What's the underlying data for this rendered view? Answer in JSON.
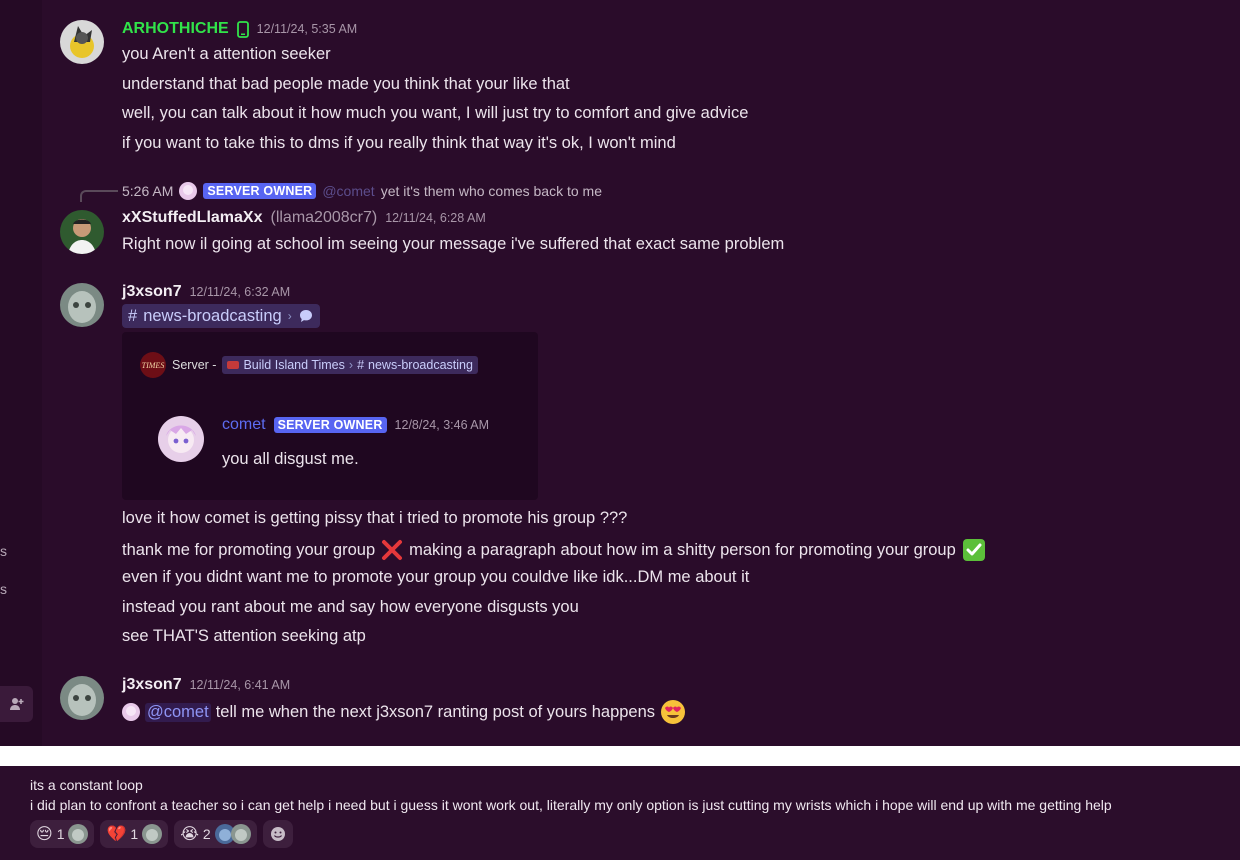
{
  "side_rail": {
    "chars": [
      "s",
      "s"
    ]
  },
  "messages": {
    "m1": {
      "user": "ARHOTHICHE",
      "device_icon": "phone-icon",
      "timestamp": "12/11/24, 5:35 AM",
      "lines": [
        "you Aren't a attention seeker",
        "understand that bad people made you think that your like that",
        "well, you can talk about it how much you want, I will just try to comfort and give advice",
        "if you want to take this to dms if you really think that way it's ok, I won't mind"
      ]
    },
    "m2": {
      "reply": {
        "time": "5:26 AM",
        "tag": "SERVER OWNER",
        "mention": "@comet",
        "text": "yet it's them who comes back to me"
      },
      "user": "xXStuffedLlamaXx",
      "handle": "(llama2008cr7)",
      "timestamp": "12/11/24, 6:28 AM",
      "line": "Right now il going at school im seeing your message i've suffered that exact same problem"
    },
    "m3": {
      "user": "j3xson7",
      "timestamp": "12/11/24, 6:32 AM",
      "channel": "news-broadcasting",
      "embed": {
        "prefix": "Server -",
        "logo_text": "TIMES",
        "server": "Build Island Times",
        "channel": "news-broadcasting",
        "quoted_user": "comet",
        "quoted_tag": "SERVER OWNER",
        "quoted_time": "12/8/24, 3:46 AM",
        "quoted_text": "you all disgust me."
      },
      "lines": [
        "love it how comet is getting pissy that i tried to promote his group ???",
        "thank me for promoting your group",
        "making a paragraph about how im a shitty person for promoting your group",
        "even if you didnt want me to promote your group you couldve like idk...DM me about it",
        "instead you rant about me and say how everyone disgusts you",
        "see THAT'S attention seeking atp"
      ]
    },
    "m4": {
      "user": "j3xson7",
      "timestamp": "12/11/24, 6:41 AM",
      "mention": "@comet",
      "text": "tell me when the next j3xson7 ranting post of yours happens"
    }
  },
  "bottom": {
    "line1": "its a constant loop",
    "line2": "i did plan to confront a teacher so i can get help i need but i guess it wont work out, literally my only option is just cutting my wrists which i hope will end up with me getting help",
    "reactions": [
      {
        "emoji": "😔",
        "count": "1"
      },
      {
        "emoji": "💔",
        "count": "1"
      },
      {
        "emoji": "😭",
        "count": "2"
      }
    ]
  },
  "colors": {
    "accent": "#5865f2",
    "green_name": "#31e34a",
    "background": "#2a0c2a"
  }
}
